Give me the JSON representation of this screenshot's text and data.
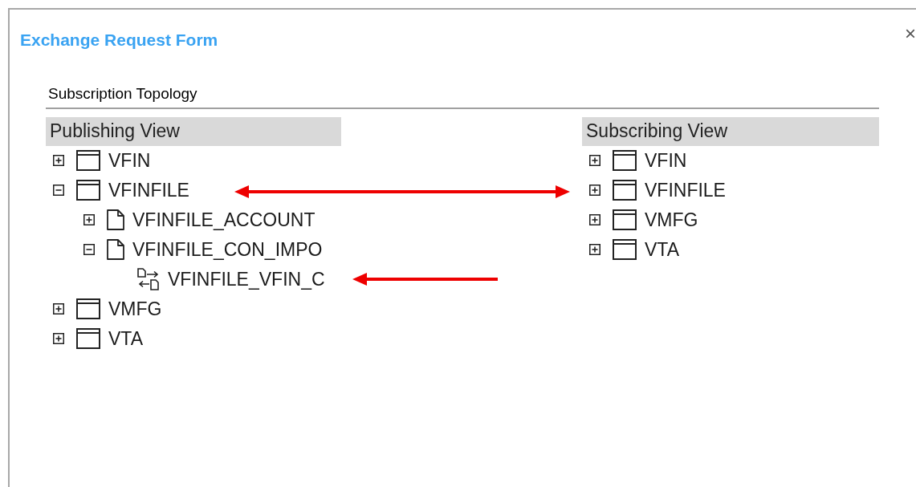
{
  "dialog": {
    "title": "Exchange Request Form",
    "close": "×"
  },
  "section": {
    "title": "Subscription Topology"
  },
  "panels": [
    {
      "title": "Publishing View",
      "items": [
        {
          "kind": "table",
          "label": "VFIN",
          "expanded": false
        },
        {
          "kind": "table",
          "label": "VFINFILE",
          "expanded": true,
          "children": [
            {
              "kind": "file",
              "label": "VFINFILE_ACCOUNT",
              "expanded": false
            },
            {
              "kind": "file",
              "label": "VFINFILE_CON_IMPO",
              "expanded": true,
              "children": [
                {
                  "kind": "link",
                  "label": "VFINFILE_VFIN_C"
                }
              ]
            }
          ]
        },
        {
          "kind": "table",
          "label": "VMFG",
          "expanded": false
        },
        {
          "kind": "table",
          "label": "VTA",
          "expanded": false
        }
      ]
    },
    {
      "title": "Subscribing View",
      "items": [
        {
          "kind": "table",
          "label": "VFIN",
          "expanded": false
        },
        {
          "kind": "table",
          "label": "VFINFILE",
          "expanded": false
        },
        {
          "kind": "table",
          "label": "VMFG",
          "expanded": false
        },
        {
          "kind": "table",
          "label": "VTA",
          "expanded": false
        }
      ]
    }
  ],
  "annotations": [
    {
      "kind": "double"
    },
    {
      "kind": "single"
    }
  ]
}
